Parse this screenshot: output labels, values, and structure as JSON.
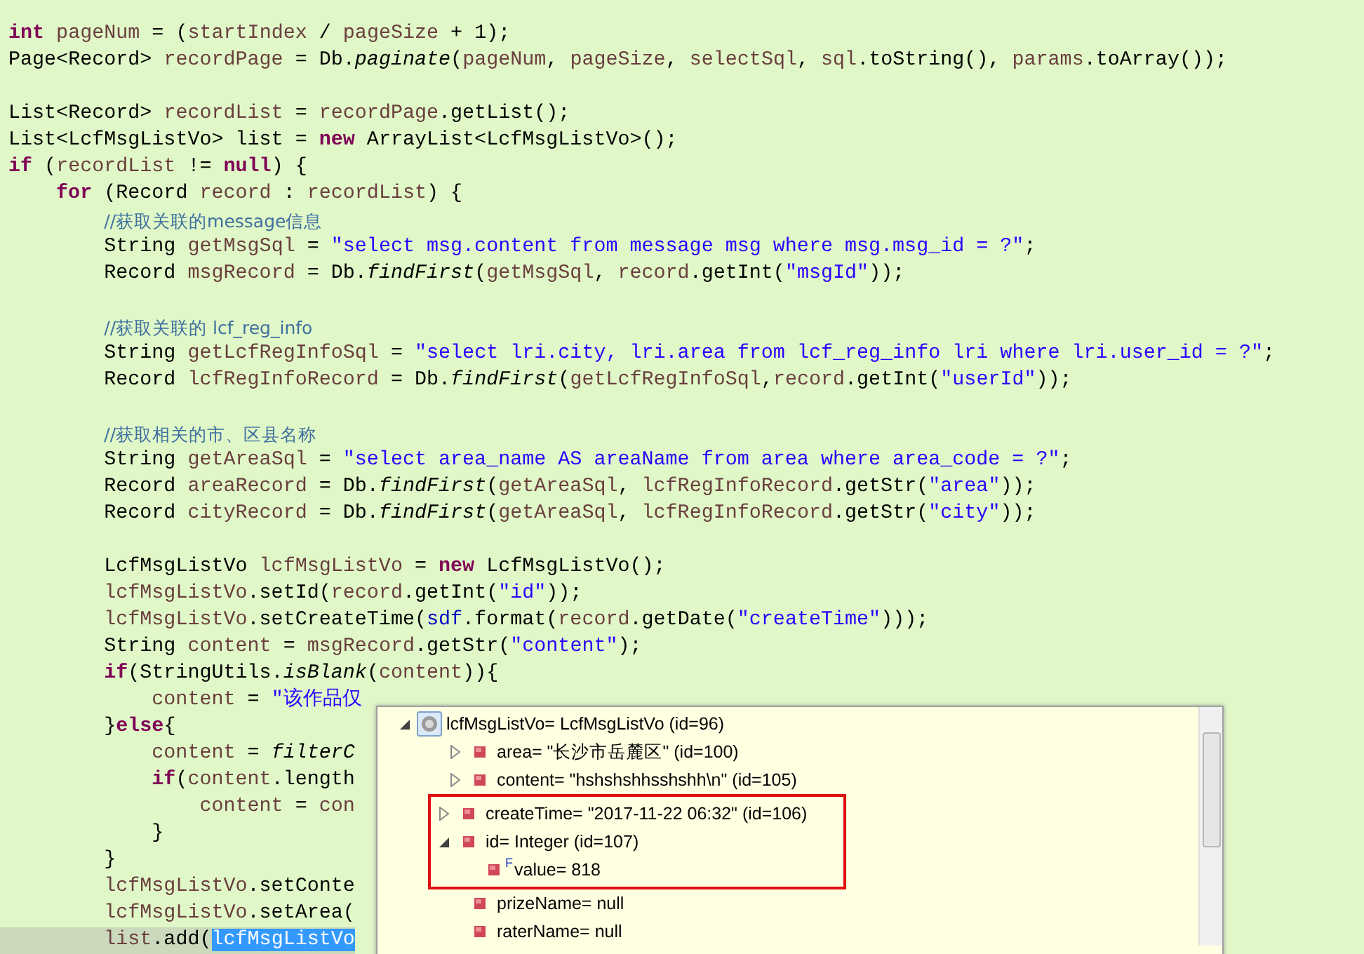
{
  "editor": {
    "lines": [
      {
        "kind": "code",
        "tokens": [
          {
            "kind": "keyword",
            "text": "int"
          },
          {
            "kind": "variable",
            "text": " pageNum"
          },
          {
            "kind": "plain",
            "text": " = ("
          },
          {
            "kind": "variable",
            "text": "startIndex"
          },
          {
            "kind": "plain",
            "text": " / "
          },
          {
            "kind": "variable",
            "text": "pageSize"
          },
          {
            "kind": "plain",
            "text": " + 1);"
          }
        ]
      },
      {
        "kind": "code",
        "tokens": [
          {
            "kind": "plain",
            "text": "Page<Record> "
          },
          {
            "kind": "variable",
            "text": "recordPage"
          },
          {
            "kind": "plain",
            "text": " = Db."
          },
          {
            "kind": "static",
            "text": "paginate"
          },
          {
            "kind": "plain",
            "text": "("
          },
          {
            "kind": "variable",
            "text": "pageNum"
          },
          {
            "kind": "plain",
            "text": ", "
          },
          {
            "kind": "variable",
            "text": "pageSize"
          },
          {
            "kind": "plain",
            "text": ", "
          },
          {
            "kind": "variable",
            "text": "selectSql"
          },
          {
            "kind": "plain",
            "text": ", "
          },
          {
            "kind": "variable",
            "text": "sql"
          },
          {
            "kind": "plain",
            "text": ".toString(), "
          },
          {
            "kind": "variable",
            "text": "params"
          },
          {
            "kind": "plain",
            "text": ".toArray());"
          }
        ]
      },
      {
        "kind": "blank"
      },
      {
        "kind": "code",
        "tokens": [
          {
            "kind": "plain",
            "text": "List<Record> "
          },
          {
            "kind": "variable",
            "text": "recordList"
          },
          {
            "kind": "plain",
            "text": " = "
          },
          {
            "kind": "variable",
            "text": "recordPage"
          },
          {
            "kind": "plain",
            "text": ".getList();"
          }
        ]
      },
      {
        "kind": "code",
        "tokens": [
          {
            "kind": "plain",
            "text": "List<LcfMsgListVo> list = "
          },
          {
            "kind": "keyword",
            "text": "new"
          },
          {
            "kind": "plain",
            "text": " ArrayList<LcfMsgListVo>();"
          }
        ]
      },
      {
        "kind": "code",
        "tokens": [
          {
            "kind": "keyword",
            "text": "if"
          },
          {
            "kind": "plain",
            "text": " ("
          },
          {
            "kind": "variable",
            "text": "recordList"
          },
          {
            "kind": "plain",
            "text": " != "
          },
          {
            "kind": "keyword",
            "text": "null"
          },
          {
            "kind": "plain",
            "text": ") {"
          }
        ],
        "children": [
          {
            "kind": "code",
            "tokens": [
              {
                "kind": "keyword",
                "text": "for"
              },
              {
                "kind": "plain",
                "text": " (Record "
              },
              {
                "kind": "variable",
                "text": "record"
              },
              {
                "kind": "plain",
                "text": " : "
              },
              {
                "kind": "variable",
                "text": "recordList"
              },
              {
                "kind": "plain",
                "text": ") {"
              }
            ],
            "children": [
              {
                "kind": "code",
                "tokens": [
                  {
                    "kind": "comment",
                    "text": "//获取关联的message信息"
                  }
                ]
              },
              {
                "kind": "code",
                "tokens": [
                  {
                    "kind": "plain",
                    "text": "String "
                  },
                  {
                    "kind": "variable",
                    "text": "getMsgSql"
                  },
                  {
                    "kind": "plain",
                    "text": " = "
                  },
                  {
                    "kind": "string",
                    "text": "\"select msg.content from message msg where msg.msg_id = ?\""
                  },
                  {
                    "kind": "plain",
                    "text": ";"
                  }
                ]
              },
              {
                "kind": "code",
                "tokens": [
                  {
                    "kind": "plain",
                    "text": "Record "
                  },
                  {
                    "kind": "variable",
                    "text": "msgRecord"
                  },
                  {
                    "kind": "plain",
                    "text": " = Db."
                  },
                  {
                    "kind": "static",
                    "text": "findFirst"
                  },
                  {
                    "kind": "plain",
                    "text": "("
                  },
                  {
                    "kind": "variable",
                    "text": "getMsgSql"
                  },
                  {
                    "kind": "plain",
                    "text": ", "
                  },
                  {
                    "kind": "variable",
                    "text": "record"
                  },
                  {
                    "kind": "plain",
                    "text": ".getInt("
                  },
                  {
                    "kind": "string",
                    "text": "\"msgId\""
                  },
                  {
                    "kind": "plain",
                    "text": "));"
                  }
                ]
              },
              {
                "kind": "blank"
              },
              {
                "kind": "code",
                "tokens": [
                  {
                    "kind": "comment",
                    "text": "//获取关联的 lcf_reg_info"
                  }
                ]
              },
              {
                "kind": "code",
                "tokens": [
                  {
                    "kind": "plain",
                    "text": "String "
                  },
                  {
                    "kind": "variable",
                    "text": "getLcfRegInfoSql"
                  },
                  {
                    "kind": "plain",
                    "text": " = "
                  },
                  {
                    "kind": "string",
                    "text": "\"select lri.city, lri.area from lcf_reg_info lri where lri.user_id = ?\""
                  },
                  {
                    "kind": "plain",
                    "text": ";"
                  }
                ]
              },
              {
                "kind": "code",
                "tokens": [
                  {
                    "kind": "plain",
                    "text": "Record "
                  },
                  {
                    "kind": "variable",
                    "text": "lcfRegInfoRecord"
                  },
                  {
                    "kind": "plain",
                    "text": " = Db."
                  },
                  {
                    "kind": "static",
                    "text": "findFirst"
                  },
                  {
                    "kind": "plain",
                    "text": "("
                  },
                  {
                    "kind": "variable",
                    "text": "getLcfRegInfoSql"
                  },
                  {
                    "kind": "plain",
                    "text": ","
                  },
                  {
                    "kind": "variable",
                    "text": "record"
                  },
                  {
                    "kind": "plain",
                    "text": ".getInt("
                  },
                  {
                    "kind": "string",
                    "text": "\"userId\""
                  },
                  {
                    "kind": "plain",
                    "text": "));"
                  }
                ]
              },
              {
                "kind": "blank"
              },
              {
                "kind": "code",
                "tokens": [
                  {
                    "kind": "comment",
                    "text": "//获取相关的市、区县名称"
                  }
                ]
              },
              {
                "kind": "code",
                "tokens": [
                  {
                    "kind": "plain",
                    "text": "String "
                  },
                  {
                    "kind": "variable",
                    "text": "getAreaSql"
                  },
                  {
                    "kind": "plain",
                    "text": " = "
                  },
                  {
                    "kind": "string",
                    "text": "\"select area_name AS areaName from area where area_code = ?\""
                  },
                  {
                    "kind": "plain",
                    "text": ";"
                  }
                ]
              },
              {
                "kind": "code",
                "tokens": [
                  {
                    "kind": "plain",
                    "text": "Record "
                  },
                  {
                    "kind": "variable",
                    "text": "areaRecord"
                  },
                  {
                    "kind": "plain",
                    "text": " = Db."
                  },
                  {
                    "kind": "static",
                    "text": "findFirst"
                  },
                  {
                    "kind": "plain",
                    "text": "("
                  },
                  {
                    "kind": "variable",
                    "text": "getAreaSql"
                  },
                  {
                    "kind": "plain",
                    "text": ", "
                  },
                  {
                    "kind": "variable",
                    "text": "lcfRegInfoRecord"
                  },
                  {
                    "kind": "plain",
                    "text": ".getStr("
                  },
                  {
                    "kind": "string",
                    "text": "\"area\""
                  },
                  {
                    "kind": "plain",
                    "text": "));"
                  }
                ]
              },
              {
                "kind": "code",
                "tokens": [
                  {
                    "kind": "plain",
                    "text": "Record "
                  },
                  {
                    "kind": "variable",
                    "text": "cityRecord"
                  },
                  {
                    "kind": "plain",
                    "text": " = Db."
                  },
                  {
                    "kind": "static",
                    "text": "findFirst"
                  },
                  {
                    "kind": "plain",
                    "text": "("
                  },
                  {
                    "kind": "variable",
                    "text": "getAreaSql"
                  },
                  {
                    "kind": "plain",
                    "text": ", "
                  },
                  {
                    "kind": "variable",
                    "text": "lcfRegInfoRecord"
                  },
                  {
                    "kind": "plain",
                    "text": ".getStr("
                  },
                  {
                    "kind": "string",
                    "text": "\"city\""
                  },
                  {
                    "kind": "plain",
                    "text": "));"
                  }
                ]
              },
              {
                "kind": "blank"
              },
              {
                "kind": "code",
                "tokens": [
                  {
                    "kind": "plain",
                    "text": "LcfMsgListVo "
                  },
                  {
                    "kind": "variable",
                    "text": "lcfMsgListVo"
                  },
                  {
                    "kind": "plain",
                    "text": " = "
                  },
                  {
                    "kind": "keyword",
                    "text": "new"
                  },
                  {
                    "kind": "plain",
                    "text": " LcfMsgListVo();"
                  }
                ]
              },
              {
                "kind": "code",
                "tokens": [
                  {
                    "kind": "variable",
                    "text": "lcfMsgListVo"
                  },
                  {
                    "kind": "plain",
                    "text": ".setId("
                  },
                  {
                    "kind": "variable",
                    "text": "record"
                  },
                  {
                    "kind": "plain",
                    "text": ".getInt("
                  },
                  {
                    "kind": "string",
                    "text": "\"id\""
                  },
                  {
                    "kind": "plain",
                    "text": "));"
                  }
                ]
              },
              {
                "kind": "code",
                "tokens": [
                  {
                    "kind": "variable",
                    "text": "lcfMsgListVo"
                  },
                  {
                    "kind": "plain",
                    "text": ".setCreateTime("
                  },
                  {
                    "kind": "field",
                    "text": "sdf"
                  },
                  {
                    "kind": "plain",
                    "text": ".format("
                  },
                  {
                    "kind": "variable",
                    "text": "record"
                  },
                  {
                    "kind": "plain",
                    "text": ".getDate("
                  },
                  {
                    "kind": "string",
                    "text": "\"createTime\""
                  },
                  {
                    "kind": "plain",
                    "text": ")));"
                  }
                ]
              },
              {
                "kind": "code",
                "tokens": [
                  {
                    "kind": "plain",
                    "text": "String "
                  },
                  {
                    "kind": "variable",
                    "text": "content"
                  },
                  {
                    "kind": "plain",
                    "text": " = "
                  },
                  {
                    "kind": "variable",
                    "text": "msgRecord"
                  },
                  {
                    "kind": "plain",
                    "text": ".getStr("
                  },
                  {
                    "kind": "string",
                    "text": "\"content\""
                  },
                  {
                    "kind": "plain",
                    "text": ");"
                  }
                ]
              },
              {
                "kind": "code",
                "tokens": [
                  {
                    "kind": "keyword",
                    "text": "if"
                  },
                  {
                    "kind": "plain",
                    "text": "(StringUtils."
                  },
                  {
                    "kind": "static",
                    "text": "isBlank"
                  },
                  {
                    "kind": "plain",
                    "text": "("
                  },
                  {
                    "kind": "variable",
                    "text": "content"
                  },
                  {
                    "kind": "plain",
                    "text": ")){"
                  }
                ],
                "children": [
                  {
                    "kind": "code",
                    "tokens": [
                      {
                        "kind": "variable",
                        "text": "content"
                      },
                      {
                        "kind": "plain",
                        "text": " = "
                      },
                      {
                        "kind": "string",
                        "text": "\"该作品仅"
                      }
                    ]
                  }
                ]
              },
              {
                "kind": "code",
                "tokens": [
                  {
                    "kind": "plain",
                    "text": "}"
                  },
                  {
                    "kind": "keyword",
                    "text": "else"
                  },
                  {
                    "kind": "plain",
                    "text": "{"
                  }
                ],
                "children": [
                  {
                    "kind": "code",
                    "tokens": [
                      {
                        "kind": "variable",
                        "text": "content"
                      },
                      {
                        "kind": "plain",
                        "text": " = "
                      },
                      {
                        "kind": "static",
                        "text": "filterC"
                      }
                    ]
                  },
                  {
                    "kind": "code",
                    "tokens": [
                      {
                        "kind": "keyword",
                        "text": "if"
                      },
                      {
                        "kind": "plain",
                        "text": "("
                      },
                      {
                        "kind": "variable",
                        "text": "content"
                      },
                      {
                        "kind": "plain",
                        "text": ".length"
                      }
                    ],
                    "children": [
                      {
                        "kind": "code",
                        "tokens": [
                          {
                            "kind": "variable",
                            "text": "content"
                          },
                          {
                            "kind": "plain",
                            "text": " = "
                          },
                          {
                            "kind": "variable",
                            "text": "con"
                          }
                        ]
                      }
                    ]
                  },
                  {
                    "kind": "code",
                    "tokens": [
                      {
                        "kind": "plain",
                        "text": "}"
                      }
                    ]
                  }
                ]
              },
              {
                "kind": "code",
                "tokens": [
                  {
                    "kind": "plain",
                    "text": "}"
                  }
                ]
              },
              {
                "kind": "code",
                "tokens": [
                  {
                    "kind": "variable",
                    "text": "lcfMsgListVo"
                  },
                  {
                    "kind": "plain",
                    "text": ".setConte"
                  }
                ]
              },
              {
                "kind": "code",
                "tokens": [
                  {
                    "kind": "variable",
                    "text": "lcfMsgListVo"
                  },
                  {
                    "kind": "plain",
                    "text": ".setArea("
                  }
                ]
              },
              {
                "kind": "code",
                "current": true,
                "tokens": [
                  {
                    "kind": "variable",
                    "text": "list"
                  },
                  {
                    "kind": "plain",
                    "text": ".add("
                  },
                  {
                    "kind": "selection",
                    "text": "lcfMsgListVo"
                  }
                ]
              }
            ]
          }
        ]
      }
    ]
  },
  "inspector": {
    "tree": [
      {
        "label": "lcfMsgListVo= LcfMsgListVo  (id=96)",
        "kind": "object",
        "expanded": true,
        "selected": true,
        "boxed": false,
        "children": [
          {
            "label": "area= \"长沙市岳麓区\" (id=100)",
            "kind": "field",
            "expanded": false,
            "selected": false,
            "boxed": false
          },
          {
            "label": "content= \"hshshshhsshshh\\n\" (id=105)",
            "kind": "field",
            "expanded": false,
            "selected": false,
            "boxed": false
          },
          {
            "label": "createTime= \"2017-11-22 06:32\" (id=106)",
            "kind": "field",
            "expanded": false,
            "selected": false,
            "boxed": true
          },
          {
            "label": "id= Integer  (id=107)",
            "kind": "field",
            "expanded": true,
            "selected": false,
            "boxed": true,
            "children": [
              {
                "label": "value= 818",
                "kind": "final",
                "modifier": "F",
                "selected": false,
                "boxed": true
              }
            ]
          },
          {
            "label": "prizeName= null",
            "kind": "field",
            "selected": false,
            "boxed": false
          },
          {
            "label": "raterName= null",
            "kind": "field",
            "selected": false,
            "boxed": false
          }
        ]
      }
    ]
  }
}
